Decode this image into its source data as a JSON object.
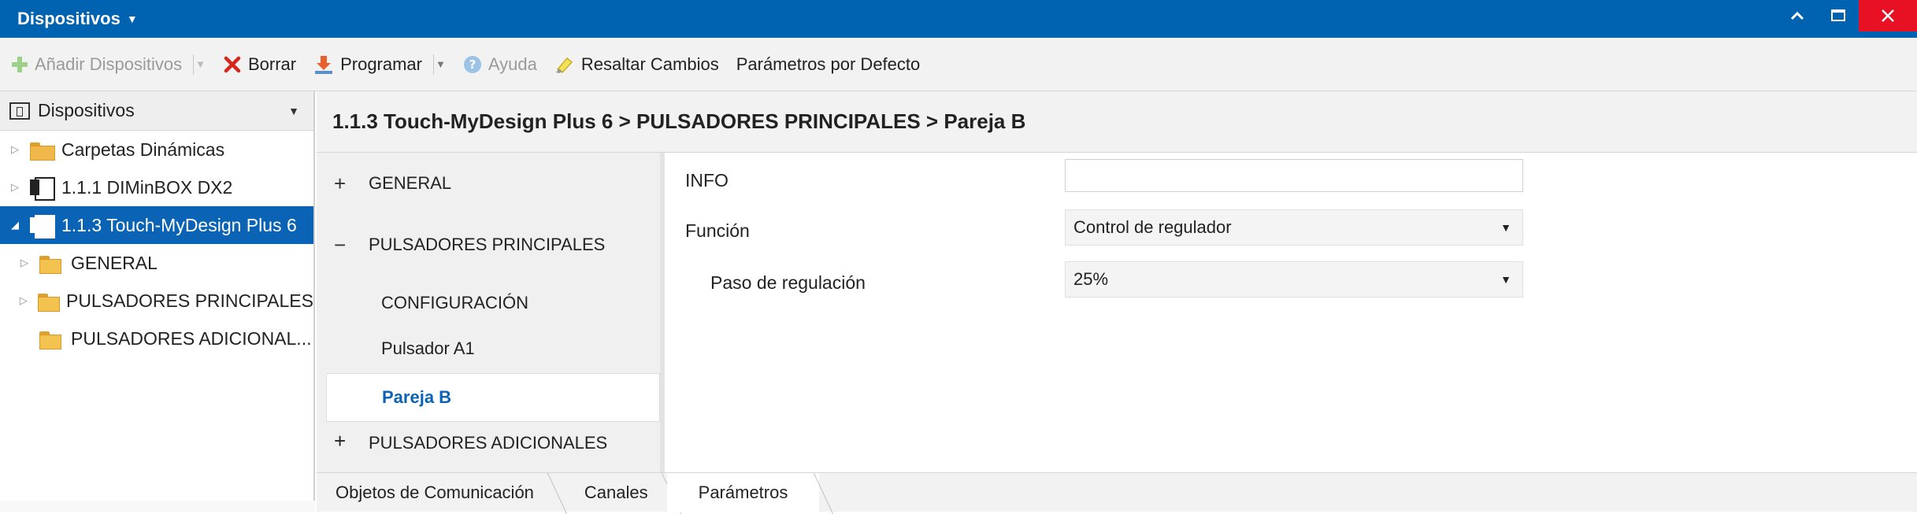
{
  "window": {
    "title": "Dispositivos",
    "controls": {
      "minimize": "^",
      "maximize": "□",
      "close": "✕"
    }
  },
  "toolbar": {
    "add_devices": "Añadir Dispositivos",
    "delete": "Borrar",
    "program": "Programar",
    "help": "Ayuda",
    "highlight_changes": "Resaltar Cambios",
    "default_params": "Parámetros por Defecto"
  },
  "left_panel": {
    "header": "Dispositivos",
    "tree": [
      {
        "label": "Carpetas Dinámicas",
        "icon": "folder-icon"
      },
      {
        "label": "1.1.1 DIMinBOX DX2",
        "icon": "device-icon"
      },
      {
        "label": "1.1.3 Touch-MyDesign Plus 6",
        "icon": "device-icon",
        "selected": true
      },
      {
        "label": "GENERAL",
        "icon": "folder-icon"
      },
      {
        "label": "PULSADORES PRINCIPALES",
        "icon": "folder-icon"
      },
      {
        "label": "PULSADORES ADICIONAL...",
        "icon": "folder-icon"
      }
    ]
  },
  "breadcrumb": "1.1.3 Touch-MyDesign Plus 6 > PULSADORES PRINCIPALES > Pareja B",
  "nav": {
    "groups": [
      {
        "sign": "+",
        "label": "GENERAL"
      },
      {
        "sign": "−",
        "label": "PULSADORES PRINCIPALES"
      },
      {
        "sign": "+",
        "label": "PULSADORES ADICIONALES"
      }
    ],
    "children": [
      "CONFIGURACIÓN",
      "Pulsador A1",
      "Pareja B"
    ]
  },
  "params": {
    "info_label": "INFO",
    "info_value": "",
    "function_label": "Función",
    "function_value": "Control de regulador",
    "step_label": "Paso de regulación",
    "step_value": "25%"
  },
  "tabs": [
    "Objetos de Comunicación",
    "Canales",
    "Parámetros"
  ],
  "colors": {
    "titlebar": "#0063b1",
    "selection": "#0a63b4",
    "close": "#e81123",
    "delete_icon": "#d9261c",
    "program_icon": "#e8612c",
    "help_icon": "#6fa8dc"
  }
}
